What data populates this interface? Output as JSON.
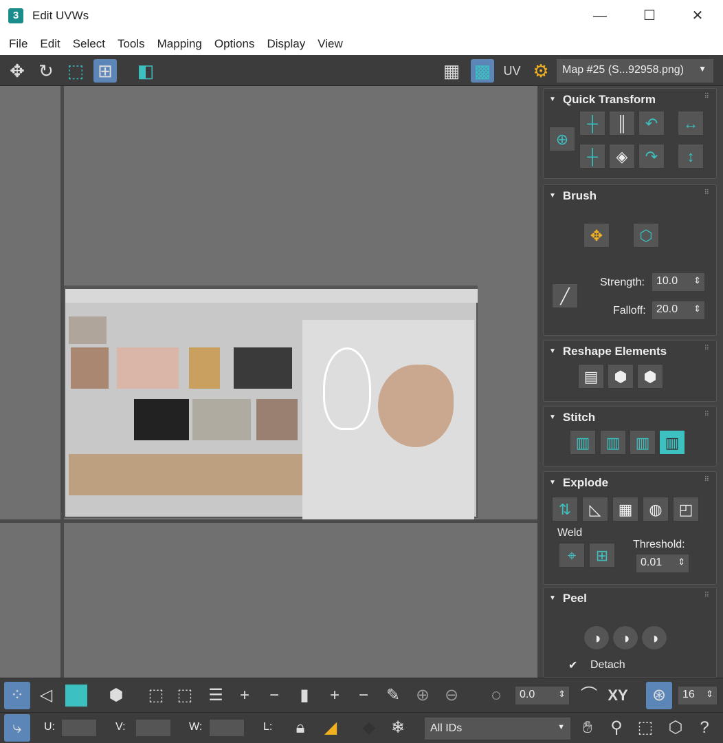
{
  "window": {
    "title": "Edit UVWs",
    "app_icon": "3"
  },
  "menu": [
    "File",
    "Edit",
    "Select",
    "Tools",
    "Mapping",
    "Options",
    "Display",
    "View"
  ],
  "toolbar": {
    "map_select": "Map #25 (S...92958.png)",
    "uv_label": "UV"
  },
  "panel": {
    "quick_transform": "Quick Transform",
    "brush": {
      "title": "Brush",
      "strength_label": "Strength:",
      "strength": "10.0",
      "falloff_label": "Falloff:",
      "falloff": "20.0"
    },
    "reshape": "Reshape Elements",
    "stitch": "Stitch",
    "explode": {
      "title": "Explode",
      "weld": "Weld",
      "threshold_label": "Threshold:",
      "threshold": "0.01"
    },
    "peel": {
      "title": "Peel",
      "detach": "Detach"
    }
  },
  "bottom": {
    "rotate_value": "0.0",
    "xy_label": "XY",
    "snap_value": "16",
    "u_label": "U:",
    "v_label": "V:",
    "w_label": "W:",
    "l_label": "L:",
    "id_filter": "All IDs"
  },
  "colors": {
    "accent": "#3cc0c0",
    "selected": "#5d86b8"
  }
}
